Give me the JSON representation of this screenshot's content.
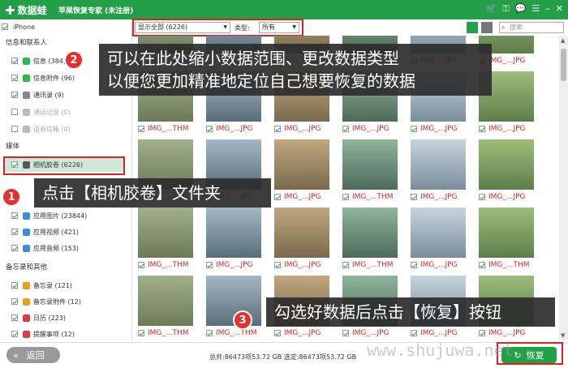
{
  "titlebar": {
    "logo_text": "数据蛙",
    "app_title": "苹果恢复专家 (未注册)",
    "icons": [
      "cart-icon",
      "key-icon",
      "chat-icon",
      "menu-icon",
      "minimize-icon",
      "close-icon"
    ]
  },
  "sidebar": {
    "device": "iPhone",
    "groups": [
      {
        "label": "信息和联系人"
      },
      {
        "label": "媒体"
      },
      {
        "label": "备忘录和其他"
      }
    ],
    "items": [
      {
        "label": "信息 (384)",
        "color": "#2db84d"
      },
      {
        "label": "信息附件 (96)",
        "color": "#2db84d"
      },
      {
        "label": "通讯录 (9)",
        "color": "#888888"
      },
      {
        "label": "通话记录 (0)",
        "color": "#aaaaaa"
      },
      {
        "label": "语音信箱 (0)",
        "color": "#aaaaaa"
      },
      {
        "label": "相机胶卷 (6226)",
        "color": "#555555"
      },
      {
        "label": "应用图片 (23844)",
        "color": "#3c8ed8"
      },
      {
        "label": "应用视频 (421)",
        "color": "#3c8ed8"
      },
      {
        "label": "应用音频 (153)",
        "color": "#3c8ed8"
      },
      {
        "label": "备忘录 (121)",
        "color": "#e8a020"
      },
      {
        "label": "备忘录附件 (12)",
        "color": "#e8a020"
      },
      {
        "label": "日历 (223)",
        "color": "#d84040"
      },
      {
        "label": "提醒事项 (12)",
        "color": "#d84040"
      }
    ]
  },
  "toolbar": {
    "filter_value": "显示全部 (6226)",
    "type_label": "类型:",
    "type_value": "所有",
    "search_placeholder": "搜索"
  },
  "grid": {
    "captions": [
      [
        "IMG_...THM",
        "IMG_...JPG",
        "IMG_...JPG",
        "IMG_...JPG",
        "IMG_...JPG",
        "IMG_...JPG"
      ],
      [
        "IMG_...THM",
        "IMG_...JPG",
        "IMG_...JPG",
        "IMG_...JPG",
        "IMG_...JPG",
        "IMG_...JPG"
      ],
      [
        "IMG_...THM",
        "IMG_...JPG",
        "IMG_...JPG",
        "IMG_...THM",
        "IMG_...JPG",
        "IMG_...JPG"
      ],
      [
        "IMG_...THM",
        "IMG_...JPG",
        "IMG_...JPG",
        "IMG_...THM",
        "IMG_...JPG",
        "IMG_...THM"
      ],
      [
        "IMG_...THM",
        "IMG_...THM",
        "IMG_...JPG",
        "IMG_...JPG",
        "IMG_...JPG",
        "IMG_...JPG"
      ]
    ]
  },
  "bottom": {
    "back_label": "返回",
    "stats": "总共:86473项53.72 GB 选定:86473项53.72 GB",
    "recover_label": "恢复"
  },
  "callouts": [
    {
      "num": "2",
      "text_line1": "可以在此处缩小数据范围、更改数据类型",
      "text_line2": "以便您更加精准地定位自己想要恢复的数据"
    },
    {
      "num": "1",
      "text": "点击【相机胶卷】文件夹"
    },
    {
      "num": "3",
      "text": "勾选好数据后点击【恢复】按钮"
    }
  ],
  "watermark": "www.shujuwa.net",
  "colors": {
    "brand": "#23a047",
    "highlight": "#e02020",
    "caption_red": "#dd2222"
  }
}
